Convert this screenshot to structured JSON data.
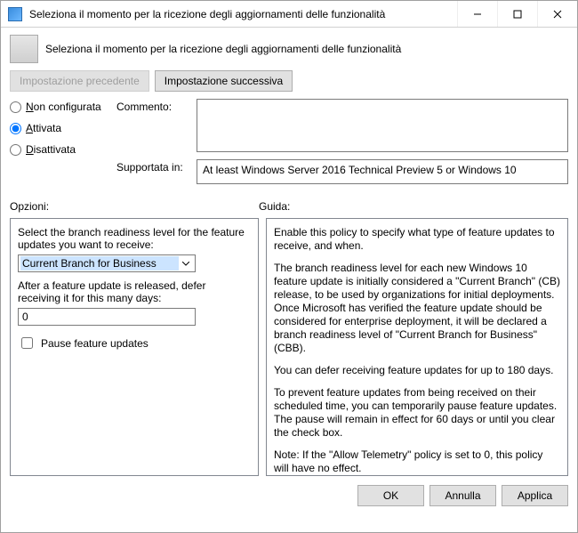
{
  "window": {
    "title": "Seleziona il momento per la ricezione degli aggiornamenti delle funzionalità"
  },
  "header": {
    "subtitle": "Seleziona il momento per la ricezione degli aggiornamenti delle funzionalità"
  },
  "nav": {
    "prev": "Impostazione precedente",
    "next": "Impostazione successiva"
  },
  "radios": {
    "not_configured_pre": "N",
    "not_configured_post": "on configurata",
    "enabled_pre": "A",
    "enabled_post": "ttivata",
    "disabled_pre": "D",
    "disabled_post": "isattivata"
  },
  "fields": {
    "comment_label": "Commento:",
    "comment_value": "",
    "supported_label": "Supportata in:",
    "supported_value": "At least Windows Server 2016 Technical Preview 5 or Windows 10"
  },
  "sections": {
    "options": "Opzioni:",
    "help": "Guida:"
  },
  "options": {
    "branch_label": "Select the branch readiness level for the feature updates you want to receive:",
    "branch_value": "Current Branch for Business",
    "defer_label": "After a feature update is released, defer receiving it for this many days:",
    "defer_value": "0",
    "pause_label": "Pause feature updates"
  },
  "help": {
    "p1": "Enable this policy to specify what type of feature updates to receive, and when.",
    "p2": "The branch readiness level for each new Windows 10 feature update is initially considered a \"Current Branch\" (CB) release, to be used by organizations for initial deployments. Once Microsoft has verified the feature update should be considered for enterprise deployment, it will be declared a branch readiness level of \"Current Branch for Business\" (CBB).",
    "p3": "You can defer receiving feature updates for up to 180 days.",
    "p4": "To prevent feature updates from being received on their scheduled time, you can temporarily pause feature updates. The pause will remain in effect for 60 days or until you clear the check box.",
    "p5": "Note: If the \"Allow Telemetry\" policy is set to 0, this policy will have no effect."
  },
  "footer": {
    "ok": "OK",
    "cancel": "Annulla",
    "apply": "Applica"
  }
}
